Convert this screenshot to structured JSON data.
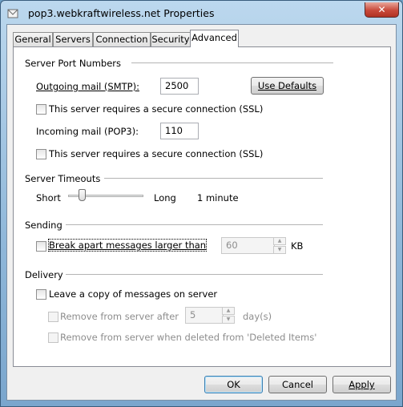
{
  "window": {
    "title": "pop3.webkraftwireless.net Properties",
    "close_glyph": "✕"
  },
  "tabs": [
    {
      "label": "General",
      "active": false
    },
    {
      "label": "Servers",
      "active": false
    },
    {
      "label": "Connection",
      "active": false
    },
    {
      "label": "Security",
      "active": false
    },
    {
      "label": "Advanced",
      "active": true
    }
  ],
  "server_ports": {
    "heading": "Server Port Numbers",
    "outgoing_label": "Outgoing mail (SMTP):",
    "outgoing_value": "2500",
    "use_defaults_label": "Use Defaults",
    "ssl_label_1": "This server requires a secure connection (SSL)",
    "incoming_label": "Incoming mail (POP3):",
    "incoming_value": "110",
    "ssl_label_2": "This server requires a secure connection (SSL)"
  },
  "timeouts": {
    "heading": "Server Timeouts",
    "short_label": "Short",
    "long_label": "Long",
    "value_text": "1 minute",
    "slider_level": 0.15
  },
  "sending": {
    "heading": "Sending",
    "break_label": "Break apart messages larger than",
    "size_value": "60",
    "unit": "KB"
  },
  "delivery": {
    "heading": "Delivery",
    "leave_copy_label": "Leave a copy of messages on server",
    "remove_after_label": "Remove from server after",
    "days_value": "5",
    "days_unit": "day(s)",
    "remove_deleted_label": "Remove from server when deleted from 'Deleted Items'"
  },
  "footer": {
    "ok_label": "OK",
    "cancel_label": "Cancel",
    "apply_label": "Apply"
  }
}
